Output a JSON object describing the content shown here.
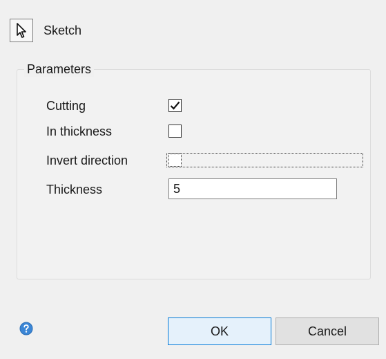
{
  "header": {
    "sketch_label": "Sketch",
    "sketch_icon": "cursor-arrow-icon"
  },
  "parameters": {
    "title": "Parameters",
    "cutting": {
      "label": "Cutting",
      "checked": true
    },
    "in_thickness": {
      "label": "In thickness",
      "checked": false
    },
    "invert_direction": {
      "label": "Invert direction",
      "checked": false,
      "focused": true
    },
    "thickness": {
      "label": "Thickness",
      "value": "5"
    }
  },
  "footer": {
    "help_icon": "help-icon",
    "ok_label": "OK",
    "cancel_label": "Cancel"
  },
  "colors": {
    "window_background": "#f0f0f0",
    "default_button_border": "#0078d7",
    "help_icon_fill": "#3b86d6"
  }
}
